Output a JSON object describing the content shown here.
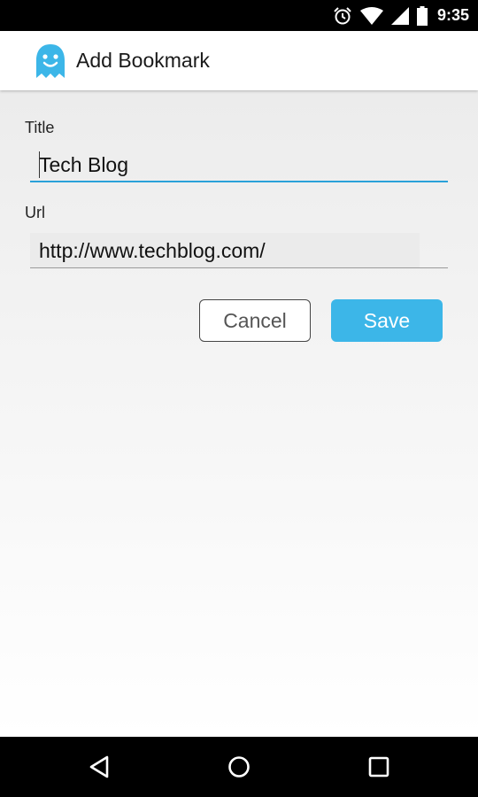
{
  "status_bar": {
    "time": "9:35",
    "icons": [
      "alarm-icon",
      "wifi-icon",
      "signal-icon",
      "battery-icon"
    ]
  },
  "app_bar": {
    "title": "Add Bookmark",
    "logo_icon": "ghost-logo-icon"
  },
  "form": {
    "title_label": "Title",
    "title_value": "Tech Blog",
    "url_label": "Url",
    "url_value": "http://www.techblog.com/"
  },
  "buttons": {
    "cancel_label": "Cancel",
    "save_label": "Save"
  },
  "nav_bar": {
    "icons": [
      "back-icon",
      "home-icon",
      "recents-icon"
    ]
  },
  "colors": {
    "accent": "#2aa1d9",
    "save_button": "#3cb6e8"
  }
}
